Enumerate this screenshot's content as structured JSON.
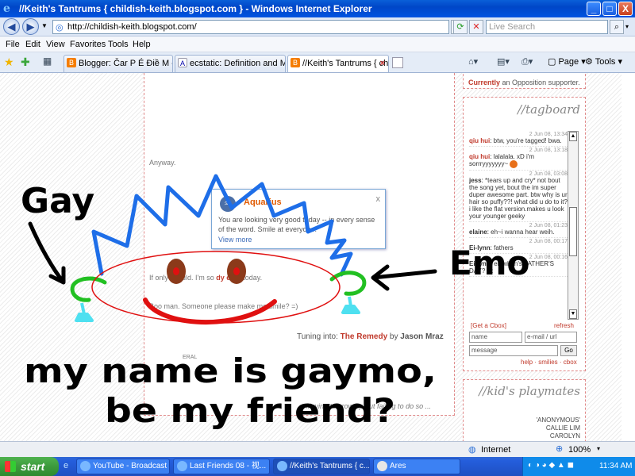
{
  "window": {
    "title": "//Keith's Tantrums { childish-keith.blogspot.com } - Windows Internet Explorer",
    "minimize": "_",
    "maximize": "□",
    "close": "X"
  },
  "address_bar": {
    "url": "http://childish-keith.blogspot.com/",
    "search_placeholder": "Live Search"
  },
  "menu": [
    "File",
    "Edit",
    "View",
    "Favorites",
    "Tools",
    "Help"
  ],
  "tabs": [
    {
      "label": "Blogger: Čar P É Điề M - C...",
      "active": false
    },
    {
      "label": "ecstatic: Definition and Much...",
      "active": false
    },
    {
      "label": "//Keith's Tantrums { childi...",
      "active": true
    }
  ],
  "commands": {
    "page": "Page",
    "tools": "Tools"
  },
  "blog": {
    "top_snippet_prefix": "Currently",
    "top_snippet_text": "an Opposition supporter.",
    "anyway": "Anyway.",
    "mood_line": "If only I could. I'm so ",
    "mood_word": "dy emo",
    "mood_suffix": " today.",
    "boo_line": "Boo man. Someone please make me smile? =)",
    "tuning_label": "Tuning into:",
    "song": "The Remedy",
    "by": "by",
    "artist": "Jason Mraz",
    "general": "ERAL",
    "tagline": "//trying to grow up but failing to do so ..."
  },
  "horoscope": {
    "sign": "Aquarius",
    "message": "You are looking very good today -- in every sense of the word. Smile at everyone!",
    "more_link": "View more",
    "close": "x"
  },
  "tagboard": {
    "title": "//tagboard",
    "entries": [
      {
        "date": "2 Jun 08, 13:34",
        "name": "qiu hui",
        "message": "btw, you're tagged! bwa."
      },
      {
        "date": "2 Jun 08, 13:18",
        "name": "qiu hui",
        "message": "lalalala. xD i'm sorrryyyyyyy~"
      },
      {
        "date": "2 Jun 08, 03:08",
        "name": "jess",
        "message": "*tears up and cry* not bout the song yet, bout the im super duper awesome part. btw why is ur hair so puffy??! what did u do to it? i like the flat version.makes u look your younger geeky"
      },
      {
        "date": "2 Jun 08, 01:23",
        "name": "elaine",
        "message": "eh~i wanna hear weih."
      },
      {
        "date": "2 Jun 08, 00:17",
        "name": "Ei-lynn",
        "message": "fathers"
      },
      {
        "date": "2 Jun 08, 00:16",
        "name": "Ei-lynn",
        "message": "eh when's FATHER'S DAY? D:"
      }
    ],
    "get_cbox": "[Get a Cbox]",
    "refresh": "refresh",
    "name_placeholder": "name",
    "url_placeholder": "e-mail / url",
    "message_placeholder": "message",
    "go": "Go",
    "footer_links": "help · smilies · cbox"
  },
  "playmates": {
    "title": "//kid's playmates",
    "names": [
      "'ANONYMOUS'",
      "CALLIE LIM",
      "CAROLYN"
    ]
  },
  "status_bar": {
    "zone": "Internet",
    "zoom": "100%"
  },
  "taskbar": {
    "start": "start",
    "tasks": [
      {
        "label": "YouTube - Broadcast ...",
        "active": false
      },
      {
        "label": "Last Friends 08 - 视...",
        "active": false
      },
      {
        "label": "//Keith's Tantrums { c...",
        "active": true
      },
      {
        "label": "Ares",
        "active": false
      }
    ],
    "clock": "11:34 AM"
  },
  "doodle": {
    "label_gay": "Gay",
    "label_emo": "Emo",
    "caption_line1": "my name is gaymo,",
    "caption_line2": "be my friend?"
  },
  "colors": {
    "title_bar": "#0046c8",
    "blog_accent": "#c0392b",
    "horoscope_sign": "#e05a00",
    "doodle_hair": "#1e6ee8",
    "doodle_mouth": "#e01010",
    "doodle_eyes": "#8b3a1a",
    "doodle_ears": "#22c022",
    "doodle_feet": "#4ee0f0",
    "taskbar": "#245edc",
    "start_button": "#3c9a3c"
  },
  "icons": [
    "ie-logo-icon",
    "back-icon",
    "forward-icon",
    "refresh-icon",
    "stop-icon",
    "search-icon",
    "favorites-star-icon",
    "add-favorites-icon",
    "home-icon",
    "print-icon",
    "page-icon",
    "gear-icon",
    "globe-icon",
    "windows-flag-icon"
  ]
}
